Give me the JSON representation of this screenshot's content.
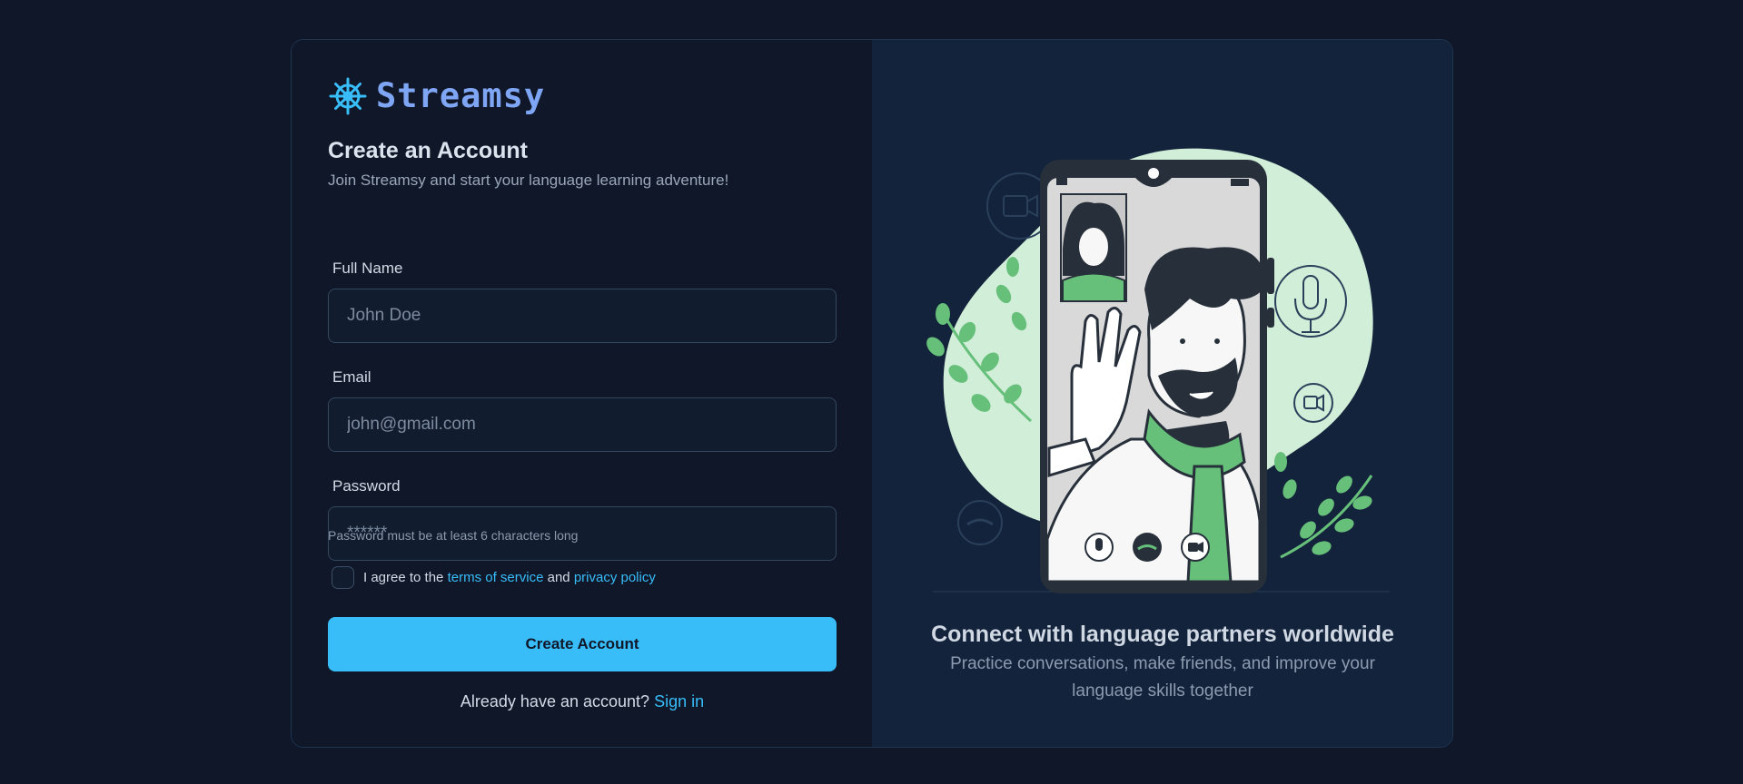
{
  "brand": {
    "name": "Streamsy",
    "icon": "ship-wheel-icon",
    "accent": "#38bdf8"
  },
  "form": {
    "title": "Create an Account",
    "subtitle": "Join Streamsy and start your language learning adventure!",
    "full_name": {
      "label": "Full Name",
      "placeholder": "John Doe"
    },
    "email": {
      "label": "Email",
      "placeholder": "john@gmail.com"
    },
    "password": {
      "label": "Password",
      "placeholder": "******",
      "hint": "Password must be at least 6 characters long"
    },
    "agree": {
      "prefix": "I agree to the",
      "terms": "terms of service",
      "and": "and",
      "privacy": "privacy policy",
      "checked": false
    },
    "submit_label": "Create Account",
    "signin_prompt": "Already have an account?",
    "signin_link": "Sign in"
  },
  "promo": {
    "title": "Connect with language partners worldwide",
    "subtitle": "Practice conversations, make friends, and improve your language skills together",
    "illustration": "video-call-illustration"
  }
}
